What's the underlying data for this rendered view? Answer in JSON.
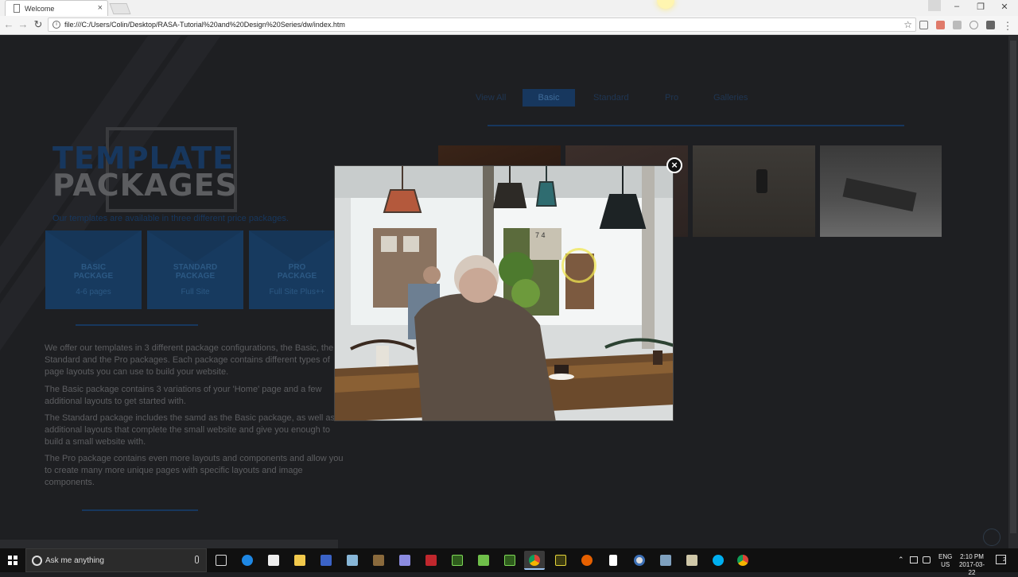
{
  "browser": {
    "tab_title": "Welcome",
    "close_tab": "×",
    "url": "file:///C:/Users/Colin/Desktop/RASA-Tutorial%20and%20Design%20Series/dw/index.htm",
    "window_controls": [
      "–",
      "❐",
      "✕"
    ]
  },
  "page": {
    "filters": [
      "View All",
      "Basic",
      "Standard",
      "Pro",
      "Galleries"
    ],
    "active_filter": "Basic",
    "title_line1": "TEMPLATE",
    "title_line2": "PACKAGES",
    "subtitle": "Our templates are available in three different price packages.",
    "packages": [
      {
        "name1": "BASIC",
        "name2": "PACKAGE",
        "sub": "4-6 pages"
      },
      {
        "name1": "STANDARD",
        "name2": "PACKAGE",
        "sub": "Full Site"
      },
      {
        "name1": "PRO",
        "name2": "PACKAGE",
        "sub": "Full Site Plus++"
      }
    ],
    "paragraphs": [
      "We offer our templates in 3 different package configurations, the Basic, the Standard and the Pro packages. Each package contains different types of page layouts you can use to build your website.",
      "The Basic package contains 3 variations of your 'Home' page and a few additional layouts to get started with.",
      "The Standard package includes the samd as the Basic package, as well as additional layouts that complete the small website and give you enough to build a small website with.",
      "The Pro package contains even more layouts and components and allow you to create many more unique pages with specific layouts and image components."
    ]
  },
  "lightbox": {
    "close_label": "×",
    "image_subject": "elderly man seated at cafe table by window, pendant lamps",
    "cafe_number": "7 4"
  },
  "taskbar": {
    "search_placeholder": "Ask me anything",
    "language": "ENG",
    "region": "US",
    "time": "2:10 PM",
    "date": "2017-03-22",
    "notification_count": "2",
    "apps": [
      "task-view",
      "edge",
      "store",
      "file-explorer",
      "app",
      "app",
      "app",
      "app",
      "filezilla",
      "dreamweaver",
      "app",
      "dreamweaver",
      "chrome",
      "fireworks",
      "firefox",
      "document",
      "app",
      "app",
      "app",
      "skype",
      "chrome"
    ]
  },
  "colors": {
    "accent_dark_blue": "#17375e",
    "page_bg": "#1e1f22",
    "taskbar_bg": "#101010"
  }
}
